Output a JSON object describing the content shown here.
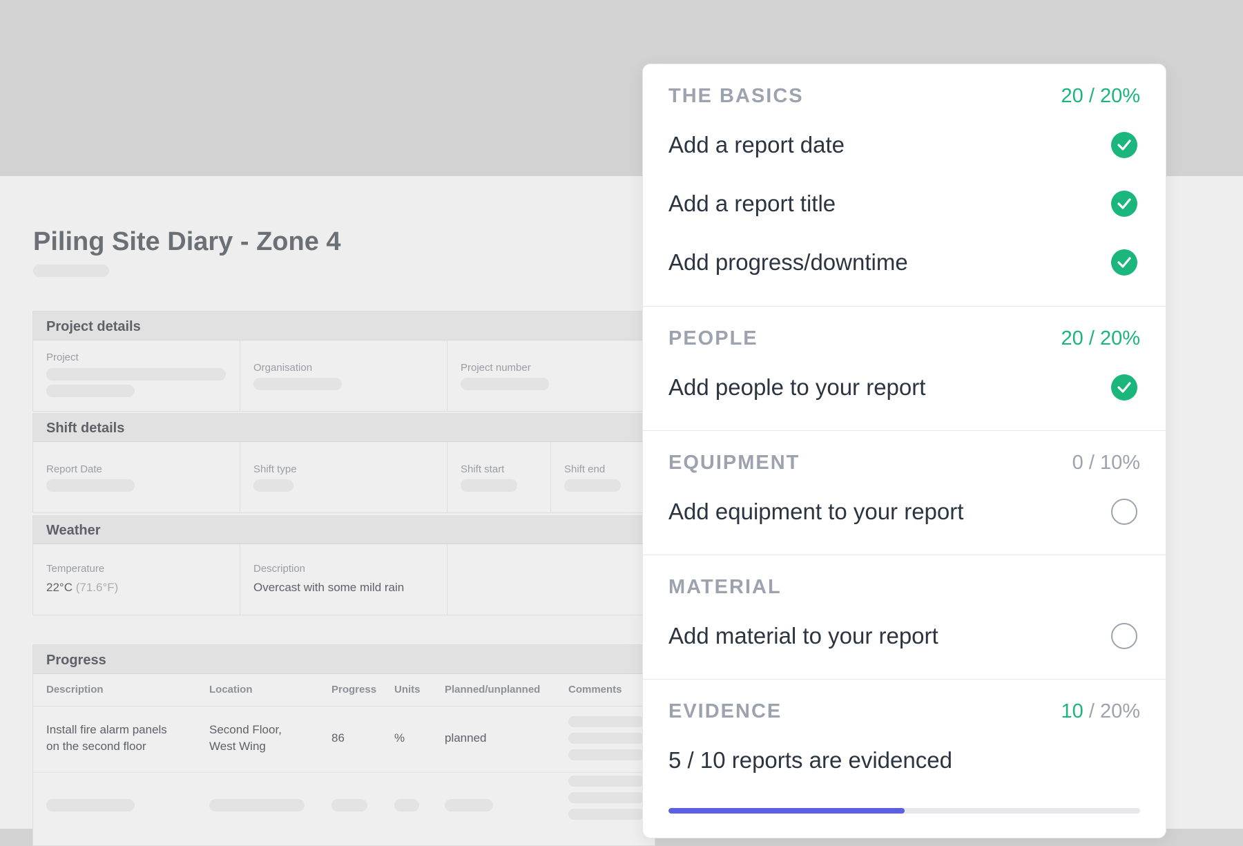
{
  "document": {
    "title": "Piling Site Diary - Zone 4",
    "project_details": {
      "heading": "Project details",
      "labels": [
        "Project",
        "Organisation",
        "Project number"
      ]
    },
    "shift_details": {
      "heading": "Shift details",
      "labels": [
        "Report Date",
        "Shift type",
        "Shift start",
        "Shift end"
      ]
    },
    "weather": {
      "heading": "Weather",
      "temperature_label": "Temperature",
      "temperature_c": "22°C",
      "temperature_f": "(71.6°F)",
      "description_label": "Description",
      "description_value": "Overcast with some mild rain"
    },
    "progress": {
      "heading": "Progress",
      "columns": [
        "Description",
        "Location",
        "Progress",
        "Units",
        "Planned/unplanned",
        "Comments"
      ],
      "row": {
        "description_line1": "Install fire alarm panels",
        "description_line2": "on the second floor",
        "location_line1": "Second Floor,",
        "location_line2": "West Wing",
        "progress": "86",
        "units": "%",
        "planned": "planned"
      }
    }
  },
  "scorecard": {
    "basics": {
      "title": "THE BASICS",
      "score_got": "20",
      "score_total": " / 20%",
      "items": [
        {
          "label": "Add a report date",
          "done": true
        },
        {
          "label": "Add a report title",
          "done": true
        },
        {
          "label": "Add progress/downtime",
          "done": true
        }
      ]
    },
    "people": {
      "title": "PEOPLE",
      "score_got": "20",
      "score_total": " / 20%",
      "items": [
        {
          "label": "Add people to your report",
          "done": true
        }
      ]
    },
    "equipment": {
      "title": "EQUIPMENT",
      "score_got": "0",
      "score_total": " / 10%",
      "items": [
        {
          "label": "Add equipment to your report",
          "done": false
        }
      ]
    },
    "material": {
      "title": "MATERIAL",
      "items": [
        {
          "label": "Add material to your report",
          "done": false
        }
      ]
    },
    "evidence": {
      "title": "EVIDENCE",
      "score_got": "10",
      "score_total": " / 20%",
      "summary": "5 / 10 reports are evidenced",
      "progress_fraction": 0.5
    },
    "colors": {
      "success": "#1ab67b",
      "progress": "#5b5fe0",
      "muted": "#9ca3af"
    }
  }
}
